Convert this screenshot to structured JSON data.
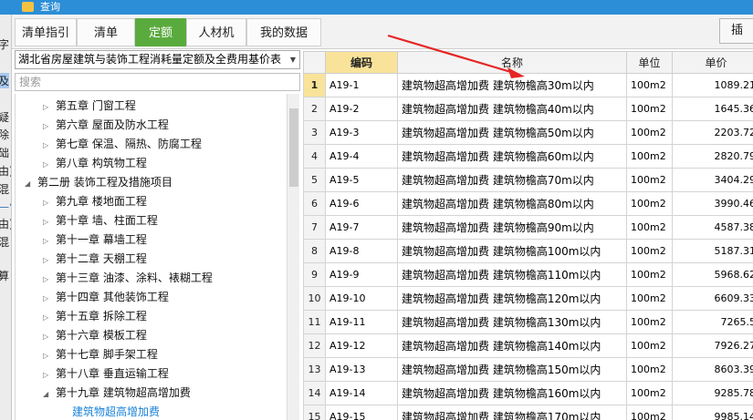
{
  "window": {
    "title": "查询"
  },
  "left_strip": {
    "texts": [
      "字",
      "及",
      "疑",
      "除",
      "础",
      "由)",
      "混",
      "一它",
      "由)",
      "混",
      "算"
    ]
  },
  "tabs": [
    {
      "label": "清单指引",
      "active": false
    },
    {
      "label": "清单",
      "active": false
    },
    {
      "label": "定额",
      "active": true
    },
    {
      "label": "人材机",
      "active": false
    },
    {
      "label": "我的数据",
      "active": false
    }
  ],
  "toolbar": {
    "insert_label": "插"
  },
  "quota_select": {
    "value": "湖北省房屋建筑与装饰工程消耗量定额及全费用基价表"
  },
  "search": {
    "placeholder": "搜索"
  },
  "tree": {
    "items": [
      {
        "label": "第五章 门窗工程",
        "level": 2,
        "expanded": false
      },
      {
        "label": "第六章 屋面及防水工程",
        "level": 2,
        "expanded": false
      },
      {
        "label": "第七章 保温、隔热、防腐工程",
        "level": 2,
        "expanded": false
      },
      {
        "label": "第八章 构筑物工程",
        "level": 2,
        "expanded": false
      },
      {
        "label": "第二册 装饰工程及措施项目",
        "level": 1,
        "expanded": true
      },
      {
        "label": "第九章 楼地面工程",
        "level": 2,
        "expanded": false
      },
      {
        "label": "第十章 墙、柱面工程",
        "level": 2,
        "expanded": false
      },
      {
        "label": "第十一章 幕墙工程",
        "level": 2,
        "expanded": false
      },
      {
        "label": "第十二章 天棚工程",
        "level": 2,
        "expanded": false
      },
      {
        "label": "第十三章 油漆、涂料、裱糊工程",
        "level": 2,
        "expanded": false
      },
      {
        "label": "第十四章 其他装饰工程",
        "level": 2,
        "expanded": false
      },
      {
        "label": "第十五章 拆除工程",
        "level": 2,
        "expanded": false
      },
      {
        "label": "第十六章 模板工程",
        "level": 2,
        "expanded": false
      },
      {
        "label": "第十七章 脚手架工程",
        "level": 2,
        "expanded": false
      },
      {
        "label": "第十八章 垂直运输工程",
        "level": 2,
        "expanded": false
      },
      {
        "label": "第十九章 建筑物超高增加费",
        "level": 2,
        "expanded": true
      },
      {
        "label": "建筑物超高增加费",
        "level": 3,
        "expanded": false,
        "leaf": true
      }
    ]
  },
  "grid": {
    "headers": [
      "",
      "编码",
      "名称",
      "单位",
      "单价"
    ],
    "rows": [
      {
        "index": "1",
        "code": "A19-1",
        "name": "建筑物超高增加费 建筑物檐高30m以内",
        "unit": "100m2",
        "price": "1089.21"
      },
      {
        "index": "2",
        "code": "A19-2",
        "name": "建筑物超高增加费 建筑物檐高40m以内",
        "unit": "100m2",
        "price": "1645.36"
      },
      {
        "index": "3",
        "code": "A19-3",
        "name": "建筑物超高增加费 建筑物檐高50m以内",
        "unit": "100m2",
        "price": "2203.72"
      },
      {
        "index": "4",
        "code": "A19-4",
        "name": "建筑物超高增加费 建筑物檐高60m以内",
        "unit": "100m2",
        "price": "2820.79"
      },
      {
        "index": "5",
        "code": "A19-5",
        "name": "建筑物超高增加费 建筑物檐高70m以内",
        "unit": "100m2",
        "price": "3404.29"
      },
      {
        "index": "6",
        "code": "A19-6",
        "name": "建筑物超高增加费 建筑物檐高80m以内",
        "unit": "100m2",
        "price": "3990.46"
      },
      {
        "index": "7",
        "code": "A19-7",
        "name": "建筑物超高增加费 建筑物檐高90m以内",
        "unit": "100m2",
        "price": "4587.38"
      },
      {
        "index": "8",
        "code": "A19-8",
        "name": "建筑物超高增加费 建筑物檐高100m以内",
        "unit": "100m2",
        "price": "5187.31"
      },
      {
        "index": "9",
        "code": "A19-9",
        "name": "建筑物超高增加费 建筑物檐高110m以内",
        "unit": "100m2",
        "price": "5968.62"
      },
      {
        "index": "10",
        "code": "A19-10",
        "name": "建筑物超高增加费 建筑物檐高120m以内",
        "unit": "100m2",
        "price": "6609.33"
      },
      {
        "index": "11",
        "code": "A19-11",
        "name": "建筑物超高增加费 建筑物檐高130m以内",
        "unit": "100m2",
        "price": "7265.5"
      },
      {
        "index": "12",
        "code": "A19-12",
        "name": "建筑物超高增加费 建筑物檐高140m以内",
        "unit": "100m2",
        "price": "7926.27"
      },
      {
        "index": "13",
        "code": "A19-13",
        "name": "建筑物超高增加费 建筑物檐高150m以内",
        "unit": "100m2",
        "price": "8603.39"
      },
      {
        "index": "14",
        "code": "A19-14",
        "name": "建筑物超高增加费 建筑物檐高160m以内",
        "unit": "100m2",
        "price": "9285.78"
      },
      {
        "index": "15",
        "code": "A19-15",
        "name": "建筑物超高增加费 建筑物檐高170m以内",
        "unit": "100m2",
        "price": "9985.14"
      }
    ]
  },
  "colors": {
    "title_bar": "#2c8ed6",
    "active_tab": "#5aab3e",
    "header_highlight": "#f9e39a",
    "leaf_text": "#1a82d8",
    "annotation": "#e62424"
  },
  "icons": {
    "title": "app-icon",
    "collapsed": "triangle-right-icon",
    "expanded": "triangle-down-icon",
    "select": "chevron-down-icon"
  }
}
